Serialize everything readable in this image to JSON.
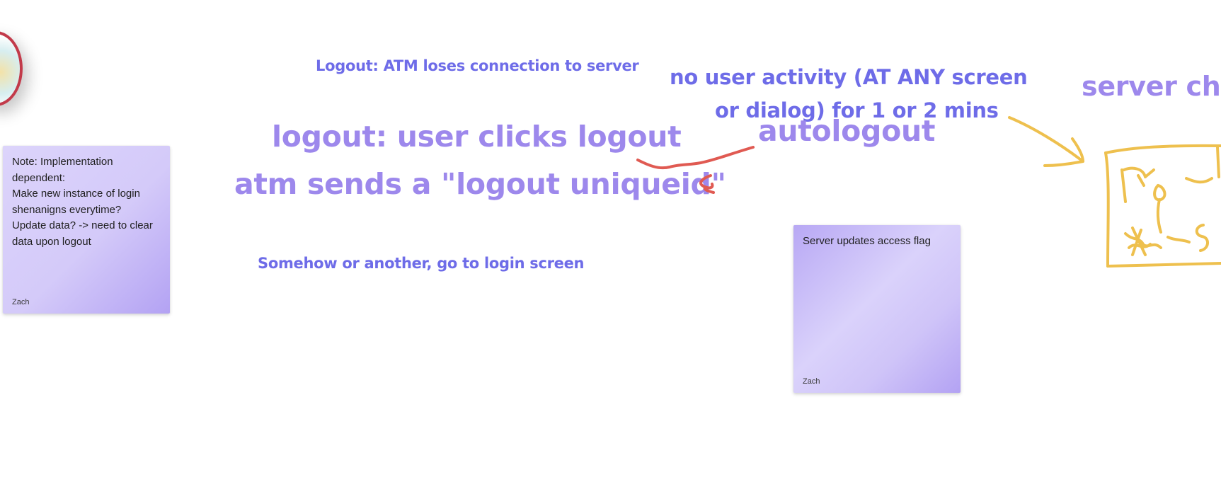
{
  "board": {
    "texts": {
      "atm_connection": "Logout: ATM loses connection to server",
      "user_clicks_logout": "logout: user clicks logout",
      "atm_sends": "atm sends a \"logout uniqueid\"",
      "go_to_login": "Somehow or another, go to login screen",
      "no_activity_line1": "no user activity (AT ANY screen",
      "no_activity_line2": "or dialog) for 1 or 2 mins",
      "autologout": "autologout",
      "server_check": "server ch"
    },
    "stickies": [
      {
        "body": "Note: Implementation dependent:\nMake new instance of login shenanigns everytime?\nUpdate data? -> need to clear data upon logout",
        "author": "Zach"
      },
      {
        "body": "Server updates access flag",
        "author": "Zach"
      }
    ]
  },
  "colors": {
    "text_blue": "#6e6ce8",
    "text_violet": "#9d88ec",
    "ink_red": "#e05a52",
    "ink_yellow": "#eec04e",
    "sticky_light": "#dcd4fb",
    "sticky_dark": "#b3a2f3",
    "avatar_ring": "#c23a4a"
  },
  "icons": {
    "avatar": "user-avatar"
  }
}
